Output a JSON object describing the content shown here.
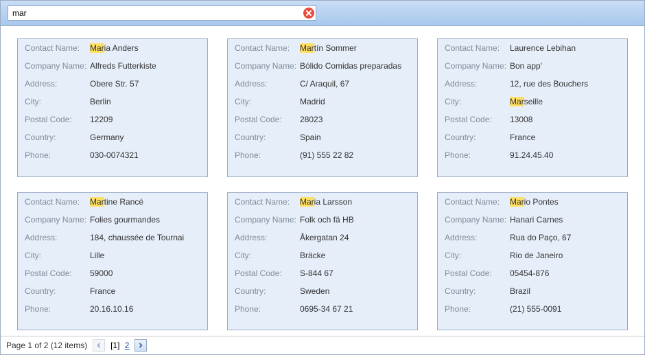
{
  "search": {
    "value": "mar",
    "highlight_prefix": "Mar"
  },
  "field_labels": {
    "contact_name": "Contact Name:",
    "company_name": "Company Name:",
    "address": "Address:",
    "city": "City:",
    "postal_code": "Postal Code:",
    "country": "Country:",
    "phone": "Phone:"
  },
  "cards": [
    {
      "contact_name": "Maria Anders",
      "company_name": "Alfreds Futterkiste",
      "address": "Obere Str. 57",
      "city": "Berlin",
      "postal_code": "12209",
      "country": "Germany",
      "phone": "030-0074321",
      "highlight_field": "contact_name"
    },
    {
      "contact_name": "Martín Sommer",
      "company_name": "Bólido Comidas preparadas",
      "address": "C/ Araquil, 67",
      "city": "Madrid",
      "postal_code": "28023",
      "country": "Spain",
      "phone": "(91) 555 22 82",
      "highlight_field": "contact_name"
    },
    {
      "contact_name": "Laurence Lebihan",
      "company_name": "Bon app'",
      "address": "12, rue des Bouchers",
      "city": "Marseille",
      "postal_code": "13008",
      "country": "France",
      "phone": "91.24.45.40",
      "highlight_field": "city"
    },
    {
      "contact_name": "Martine Rancé",
      "company_name": "Folies gourmandes",
      "address": "184, chaussée de Tournai",
      "city": "Lille",
      "postal_code": "59000",
      "country": "France",
      "phone": "20.16.10.16",
      "highlight_field": "contact_name"
    },
    {
      "contact_name": "Maria Larsson",
      "company_name": "Folk och fä HB",
      "address": "Åkergatan 24",
      "city": "Bräcke",
      "postal_code": "S-844 67",
      "country": "Sweden",
      "phone": "0695-34 67 21",
      "highlight_field": "contact_name"
    },
    {
      "contact_name": "Mario Pontes",
      "company_name": "Hanari Carnes",
      "address": "Rua do Paço, 67",
      "city": "Rio de Janeiro",
      "postal_code": "05454-876",
      "country": "Brazil",
      "phone": "(21) 555-0091",
      "highlight_field": "contact_name"
    }
  ],
  "pager": {
    "status_text": "Page 1 of 2 (12 items)",
    "current_page": 1,
    "total_pages": 2,
    "pages": [
      "1",
      "2"
    ]
  }
}
